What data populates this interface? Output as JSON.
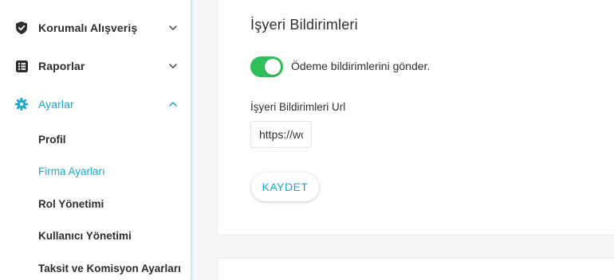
{
  "sidebar": {
    "items": [
      {
        "label": "Korumalı Alışveriş",
        "icon": "shield-check-icon",
        "chevron": "chevron-down-icon"
      },
      {
        "label": "Raporlar",
        "icon": "report-list-icon",
        "chevron": "chevron-down-icon"
      },
      {
        "label": "Ayarlar",
        "icon": "gear-icon",
        "chevron": "chevron-up-icon",
        "active": true
      }
    ],
    "subitems": [
      {
        "label": "Profil"
      },
      {
        "label": "Firma Ayarları",
        "active": true
      },
      {
        "label": "Rol Yönetimi"
      },
      {
        "label": "Kullanıcı Yönetimi"
      },
      {
        "label": "Taksit ve Komisyon Ayarları"
      }
    ]
  },
  "main": {
    "title": "İşyeri Bildirimleri",
    "toggle": {
      "label": "Ödeme bildirimlerini gönder.",
      "on": true
    },
    "url_field": {
      "label": "İşyeri Bildirimleri Url",
      "value": "https://woo"
    },
    "save_label": "KAYDET"
  },
  "colors": {
    "accent": "#1ba6d3",
    "toggle_on": "#2ebf5b",
    "text": "#2d2d2d",
    "background": "#f5f6f8"
  }
}
